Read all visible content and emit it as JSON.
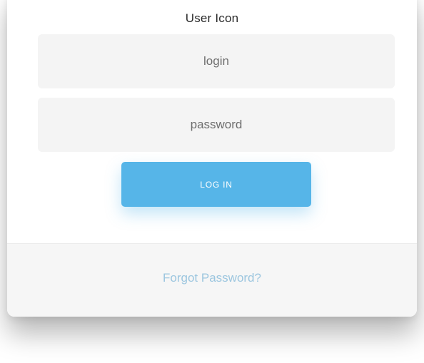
{
  "header": {
    "title": "User Icon"
  },
  "form": {
    "login_placeholder": "login",
    "password_placeholder": "password",
    "submit_label": "LOG IN"
  },
  "footer": {
    "forgot_password_label": "Forgot Password?"
  },
  "colors": {
    "button_background": "#56b5e8",
    "field_background": "#f4f4f4",
    "footer_background": "#f6f6f6",
    "link_color": "#9cc6df"
  }
}
